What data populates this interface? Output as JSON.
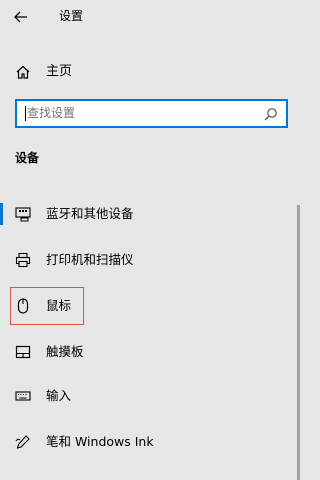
{
  "window": {
    "title": "设置"
  },
  "home": {
    "label": "主页",
    "icon": "home-icon"
  },
  "search": {
    "placeholder": "查找设置",
    "icon": "search-icon"
  },
  "section": {
    "title": "设备"
  },
  "nav": {
    "items": [
      {
        "label": "蓝牙和其他设备",
        "icon": "bluetooth-devices-icon",
        "selected": true
      },
      {
        "label": "打印机和扫描仪",
        "icon": "printer-icon"
      },
      {
        "label": "鼠标",
        "icon": "mouse-icon",
        "highlighted": true
      },
      {
        "label": "触摸板",
        "icon": "touchpad-icon"
      },
      {
        "label": "输入",
        "icon": "keyboard-icon"
      },
      {
        "label": "笔和 Windows Ink",
        "icon": "pen-icon"
      }
    ]
  },
  "colors": {
    "accent": "#0078d7",
    "highlight": "#d9534f",
    "background": "#e6e6e6"
  }
}
